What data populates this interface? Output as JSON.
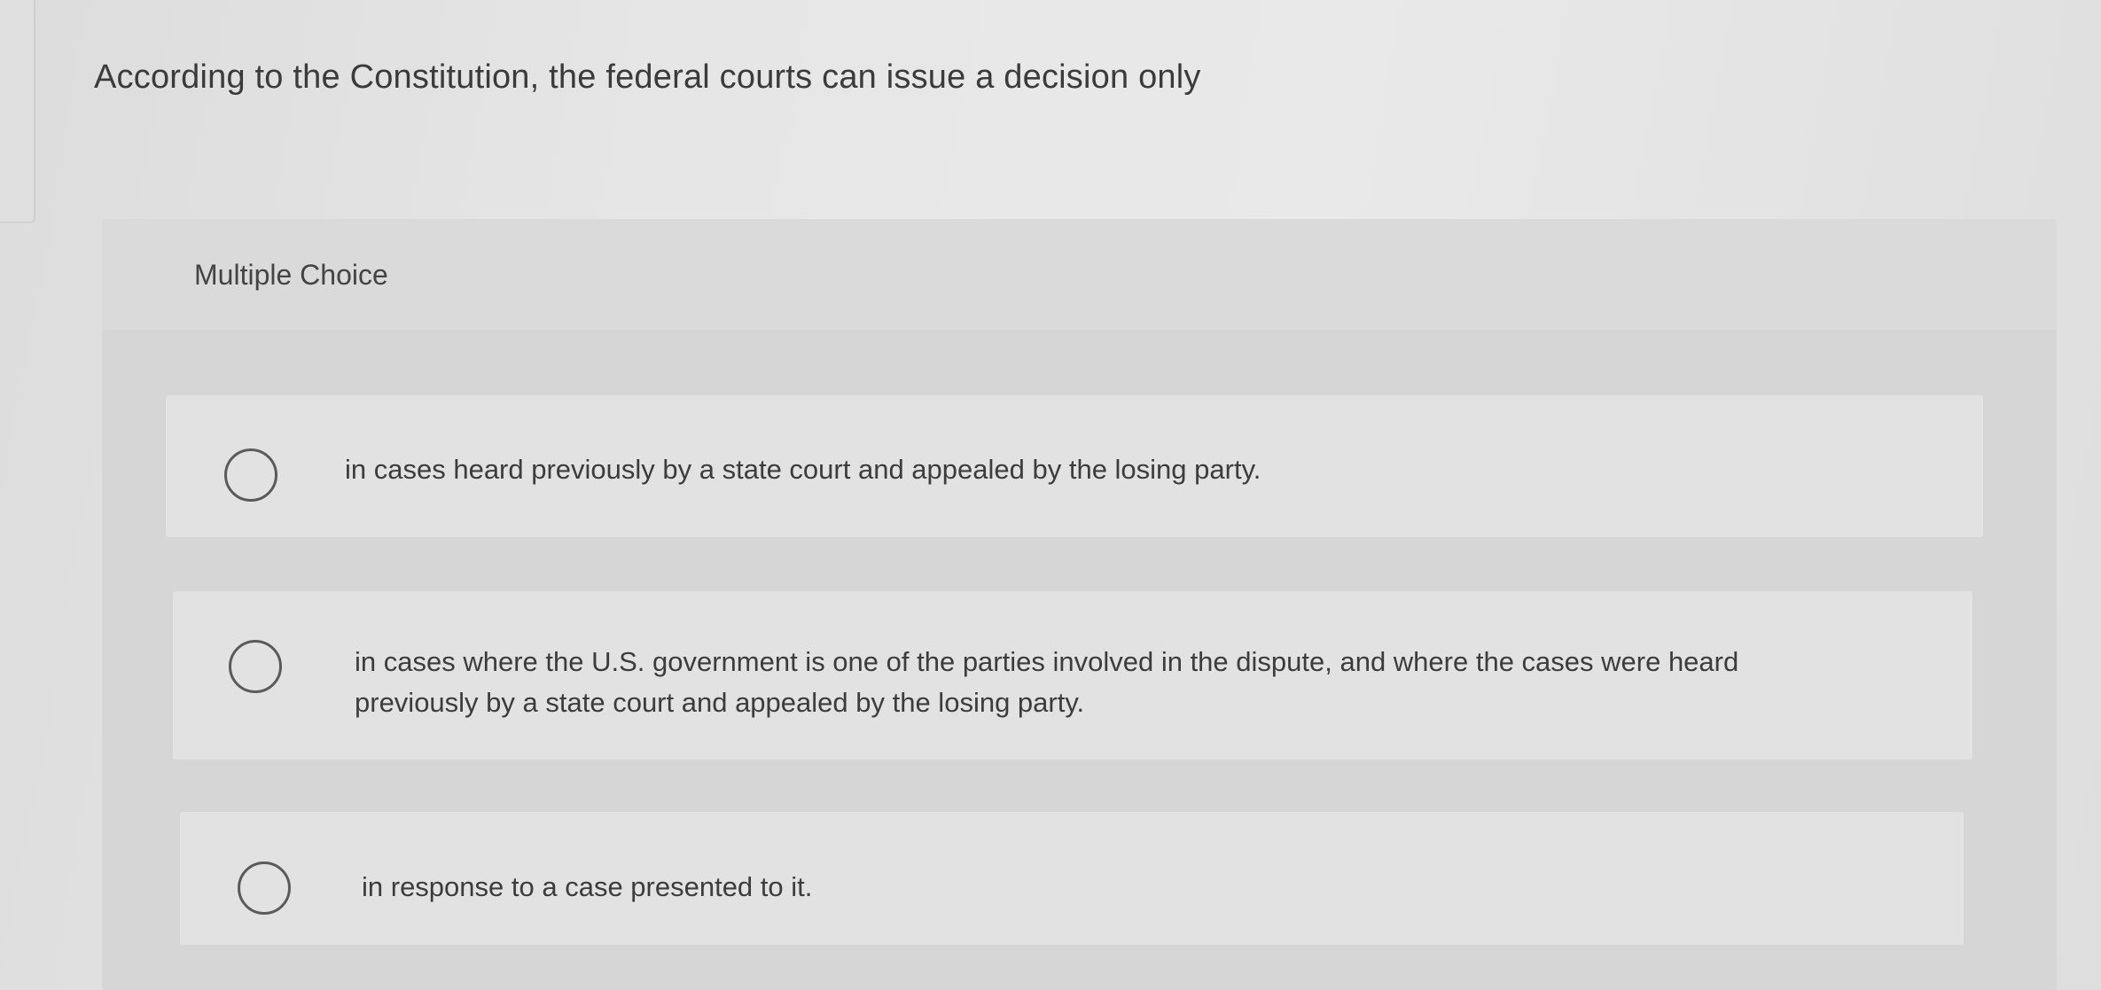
{
  "question": {
    "text": "According to the Constitution, the federal courts can issue a decision only"
  },
  "quiz": {
    "type_label": "Multiple Choice",
    "options": [
      {
        "text": "in cases heard previously by a state court and appealed by the losing party.",
        "selected": false
      },
      {
        "text": "in cases where the U.S. government is one of the parties involved in the dispute, and where the cases were heard previously by a state court and appealed by the losing party.",
        "selected": false
      },
      {
        "text": "in response to a case presented to it.",
        "selected": false
      }
    ]
  }
}
